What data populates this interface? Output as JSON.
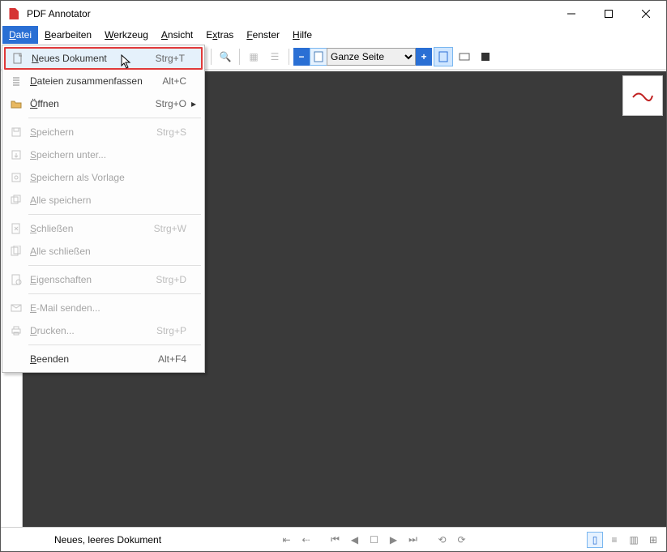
{
  "title": "PDF Annotator",
  "menubar": [
    "Datei",
    "Bearbeiten",
    "Werkzeug",
    "Ansicht",
    "Extras",
    "Fenster",
    "Hilfe"
  ],
  "zoom": {
    "selected": "Ganze Seite"
  },
  "file_menu": {
    "items": [
      {
        "label": "Neues Dokument",
        "shortcut": "Strg+T",
        "icon": "new",
        "enabled": true,
        "hover": true,
        "submenu": false,
        "highlight": true
      },
      {
        "label": "Dateien zusammenfassen",
        "shortcut": "Alt+C",
        "icon": "merge",
        "enabled": true,
        "submenu": false
      },
      {
        "label": "Öffnen",
        "shortcut": "Strg+O",
        "icon": "open",
        "enabled": true,
        "submenu": true
      },
      {
        "sep": true
      },
      {
        "label": "Speichern",
        "shortcut": "Strg+S",
        "icon": "save",
        "enabled": false
      },
      {
        "label": "Speichern unter...",
        "shortcut": "",
        "icon": "saveas",
        "enabled": false
      },
      {
        "label": "Speichern als Vorlage",
        "shortcut": "",
        "icon": "savetpl",
        "enabled": false
      },
      {
        "label": "Alle speichern",
        "shortcut": "",
        "icon": "saveall",
        "enabled": false
      },
      {
        "sep": true
      },
      {
        "label": "Schließen",
        "shortcut": "Strg+W",
        "icon": "close",
        "enabled": false
      },
      {
        "label": "Alle schließen",
        "shortcut": "",
        "icon": "closeall",
        "enabled": false
      },
      {
        "sep": true
      },
      {
        "label": "Eigenschaften",
        "shortcut": "Strg+D",
        "icon": "props",
        "enabled": false
      },
      {
        "sep": true
      },
      {
        "label": "E-Mail senden...",
        "shortcut": "",
        "icon": "mail",
        "enabled": false
      },
      {
        "label": "Drucken...",
        "shortcut": "Strg+P",
        "icon": "print",
        "enabled": false
      },
      {
        "sep": true
      },
      {
        "label": "Beenden",
        "shortcut": "Alt+F4",
        "icon": "",
        "enabled": true
      }
    ]
  },
  "status_text": "Neues, leeres Dokument"
}
